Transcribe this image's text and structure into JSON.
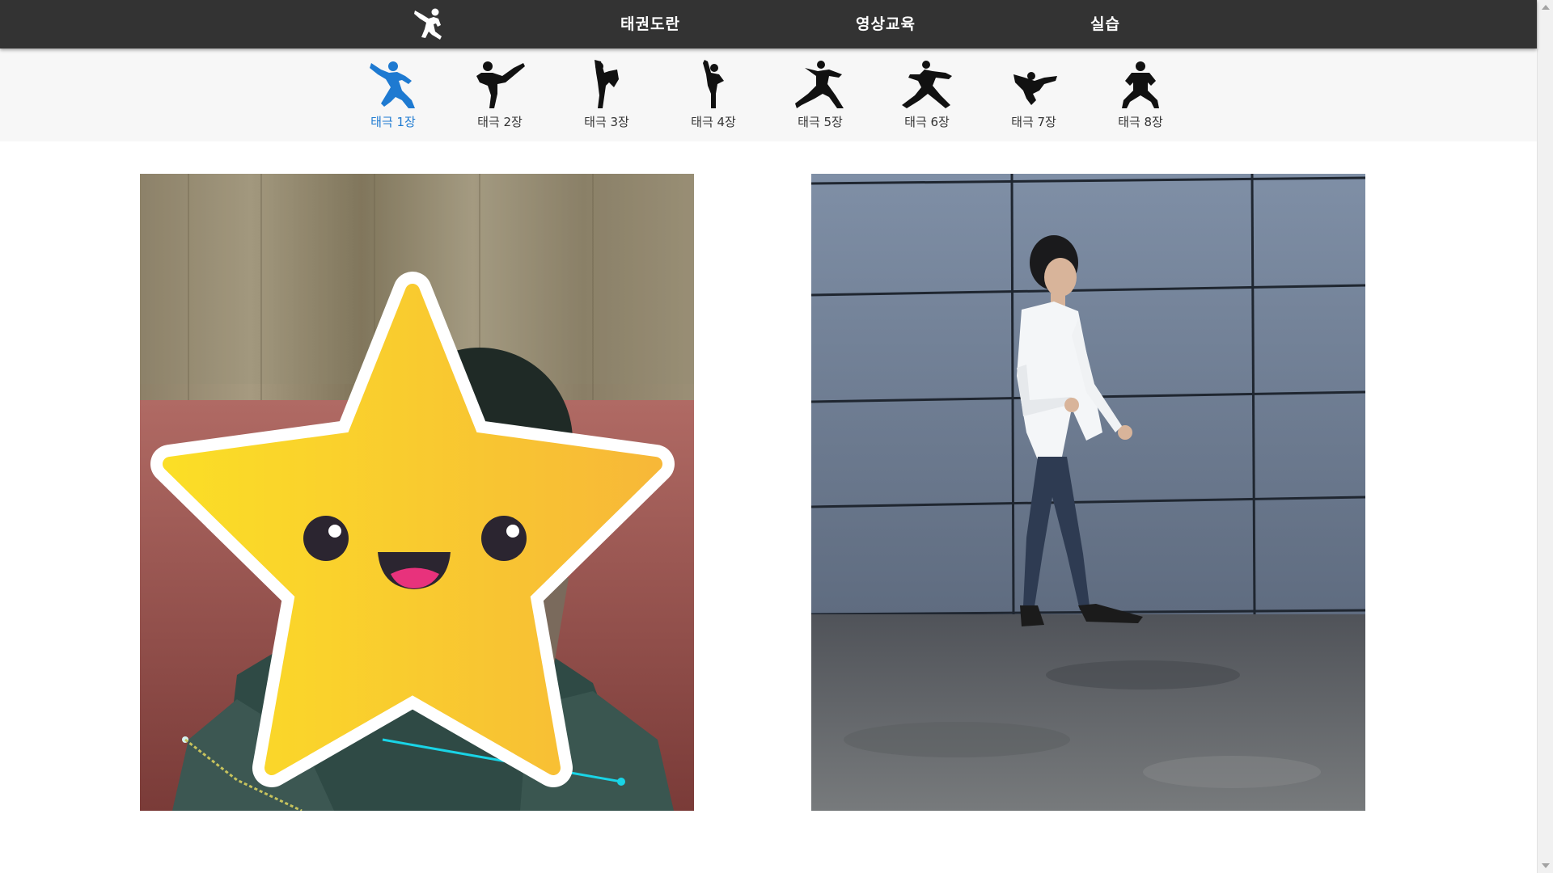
{
  "nav": {
    "logo_icon": "taekwondo-kick-logo-icon",
    "links": [
      "태권도란",
      "영상교육",
      "실습"
    ]
  },
  "forms": {
    "active_index": 0,
    "active_color": "#1e7ad1",
    "items": [
      {
        "label": "태극 1장",
        "icon": "poomsae-1-pose-icon"
      },
      {
        "label": "태극 2장",
        "icon": "poomsae-2-pose-icon"
      },
      {
        "label": "태극 3장",
        "icon": "poomsae-3-pose-icon"
      },
      {
        "label": "태극 4장",
        "icon": "poomsae-4-pose-icon"
      },
      {
        "label": "태극 5장",
        "icon": "poomsae-5-pose-icon"
      },
      {
        "label": "태극 6장",
        "icon": "poomsae-6-pose-icon"
      },
      {
        "label": "태극 7장",
        "icon": "poomsae-7-pose-icon"
      },
      {
        "label": "태극 8장",
        "icon": "poomsae-8-pose-icon"
      }
    ]
  },
  "panels": {
    "left": {
      "content": "webcam-feed-with-star-face-overlay"
    },
    "right": {
      "content": "reference-video-person-walking"
    }
  },
  "colors": {
    "topbar": "#333333",
    "formbar": "#f7f7f7",
    "star_yellow": "#f9c630"
  }
}
